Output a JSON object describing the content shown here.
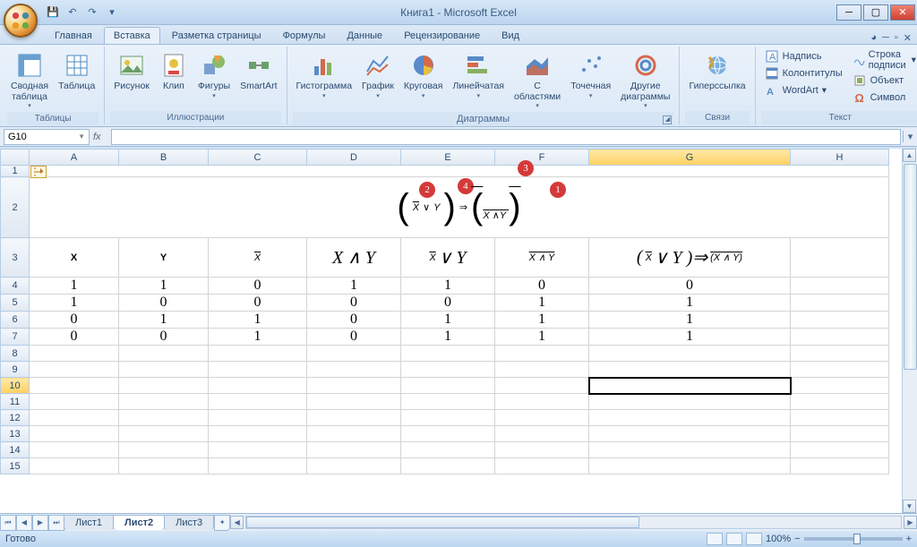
{
  "title": "Книга1 - Microsoft Excel",
  "qat": {
    "save": "💾",
    "undo": "↶",
    "redo": "↷"
  },
  "tabs": [
    "Главная",
    "Вставка",
    "Разметка страницы",
    "Формулы",
    "Данные",
    "Рецензирование",
    "Вид"
  ],
  "active_tab": 1,
  "ribbon": {
    "g1": {
      "label": "Таблицы",
      "pivot": "Сводная\nтаблица",
      "table": "Таблица"
    },
    "g2": {
      "label": "Иллюстрации",
      "pic": "Рисунок",
      "clip": "Клип",
      "shapes": "Фигуры",
      "smart": "SmartArt"
    },
    "g3": {
      "label": "Диаграммы",
      "col": "Гистограмма",
      "line": "График",
      "pie": "Круговая",
      "bar": "Линейчатая",
      "area": "С\nобластями",
      "scatter": "Точечная",
      "other": "Другие\nдиаграммы"
    },
    "g4": {
      "label": "Связи",
      "link": "Гиперссылка"
    },
    "g5": {
      "label": "Текст",
      "tb": "Надпись",
      "hf": "Колонтитулы",
      "wa": "WordArt",
      "sig": "Строка подписи",
      "obj": "Объект",
      "sym": "Символ"
    }
  },
  "namebox": "G10",
  "cols": [
    "A",
    "B",
    "C",
    "D",
    "E",
    "F",
    "G",
    "H"
  ],
  "rows_visible": [
    1,
    2,
    3,
    4,
    5,
    6,
    7,
    8,
    9,
    10,
    11,
    12,
    13,
    14,
    15
  ],
  "selected": {
    "col": "G",
    "row": 10
  },
  "formula_badges": {
    "b1": "1",
    "b2": "2",
    "b3": "3",
    "b4": "4"
  },
  "headers": {
    "A": "X",
    "B": "Y",
    "C": "X̄",
    "D": "X ∧ Y",
    "E": "X̄ ∨ Y",
    "F": "overline(X ∧ Y)",
    "G": "( X̄ ∨ Y ) ⇒ overline( X ∧ Y )"
  },
  "data": [
    {
      "A": "1",
      "B": "1",
      "C": "0",
      "D": "1",
      "E": "1",
      "F": "0",
      "G": "0"
    },
    {
      "A": "1",
      "B": "0",
      "C": "0",
      "D": "0",
      "E": "0",
      "F": "1",
      "G": "1"
    },
    {
      "A": "0",
      "B": "1",
      "C": "1",
      "D": "0",
      "E": "1",
      "F": "1",
      "G": "1"
    },
    {
      "A": "0",
      "B": "0",
      "C": "1",
      "D": "0",
      "E": "1",
      "F": "1",
      "G": "1"
    }
  ],
  "sheets": [
    "Лист1",
    "Лист2",
    "Лист3"
  ],
  "active_sheet": 1,
  "status": "Готово",
  "zoom": "100%"
}
